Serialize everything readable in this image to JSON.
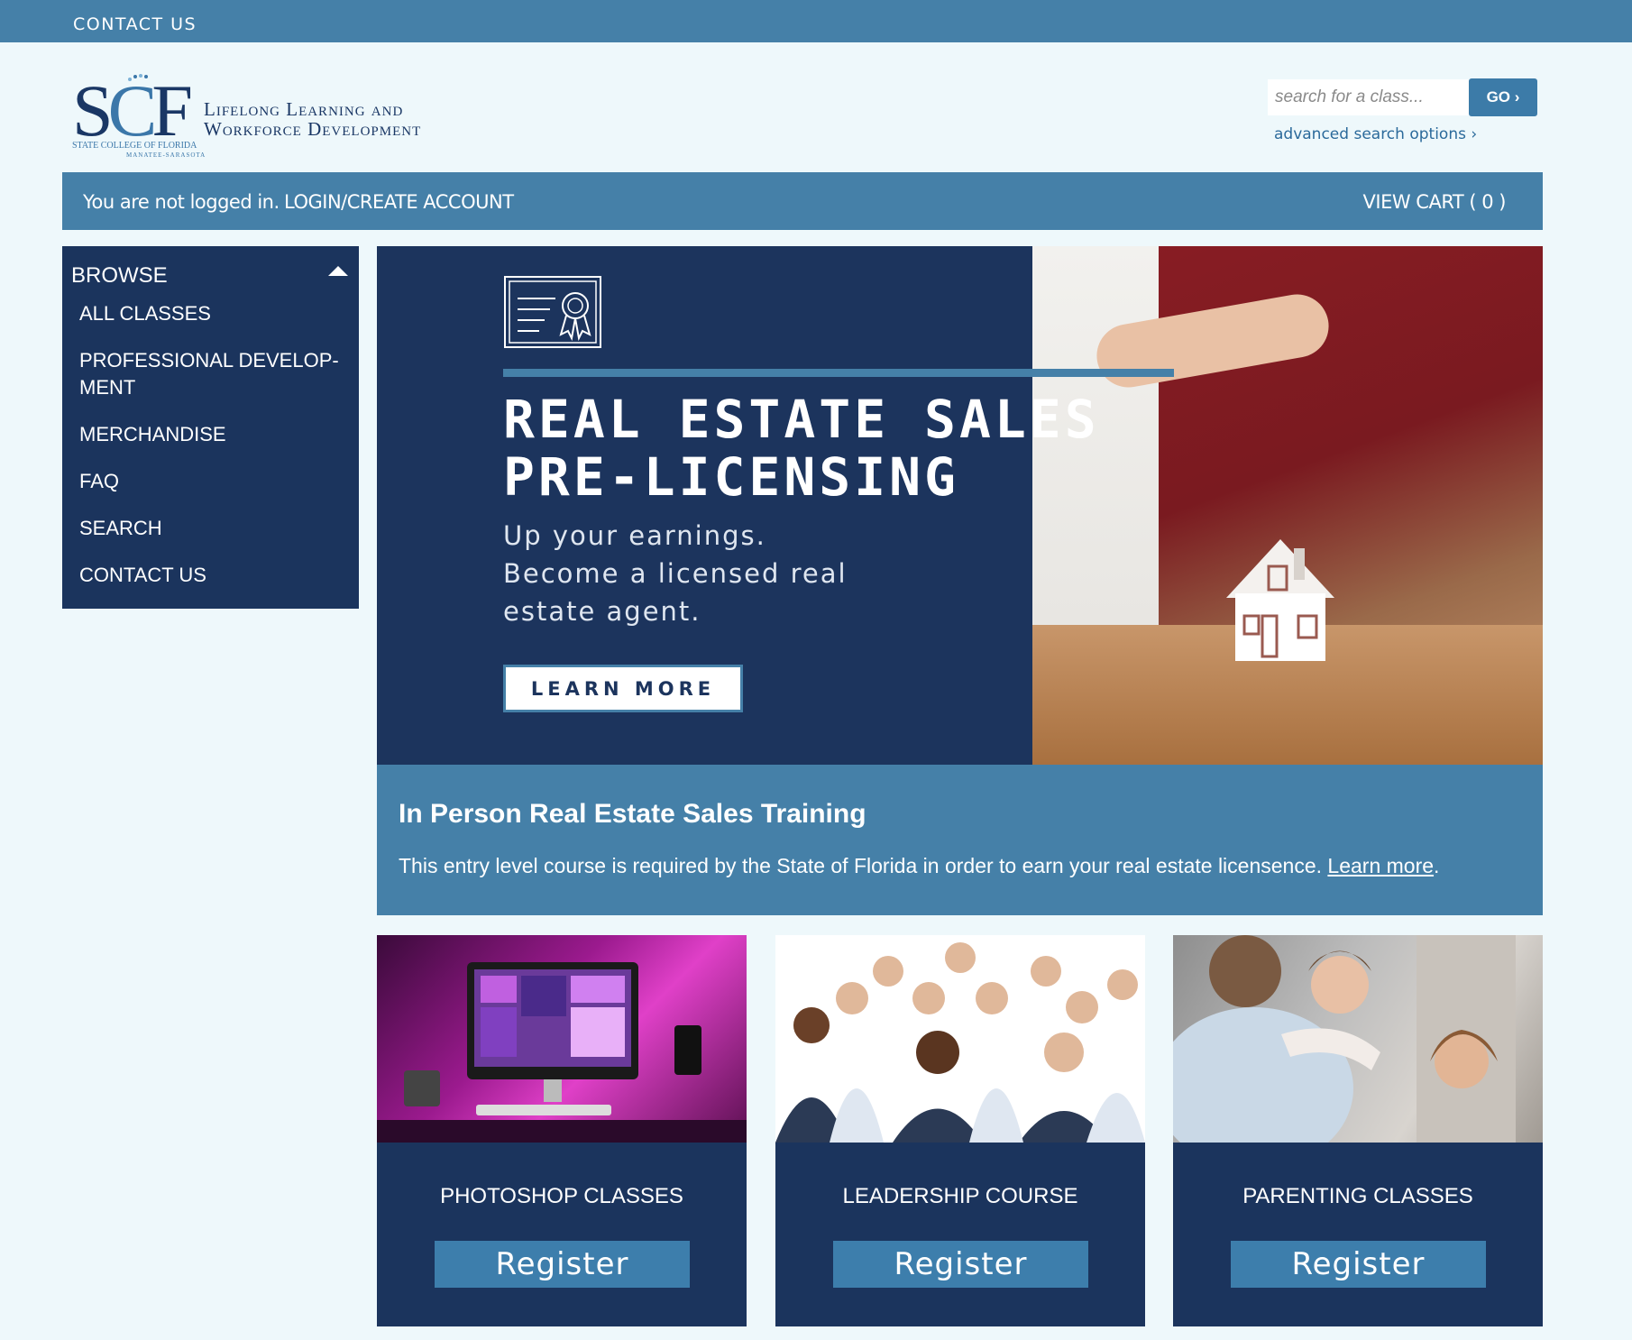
{
  "topbar": {
    "contact_label": "CONTACT US"
  },
  "logo": {
    "mark_s": "S",
    "mark_c": "C",
    "mark_f": "F",
    "line1": "Lifelong Learning and",
    "line2": "Workforce Development",
    "college": "STATE COLLEGE OF FLORIDA",
    "campus": "MANATEE-SARASOTA"
  },
  "search": {
    "placeholder": "search for a class...",
    "go_label": "GO ›",
    "advanced_label": "advanced search options ›"
  },
  "userbar": {
    "status": "You are not logged in.",
    "login_label": "LOGIN/CREATE ACCOUNT",
    "cart_label": "VIEW CART ( 0 )"
  },
  "sidebar": {
    "heading": "BROWSE",
    "items": [
      {
        "label": "ALL CLASSES"
      },
      {
        "label": "PROFESSIONAL DEVELOP-MENT"
      },
      {
        "label": "MERCHANDISE"
      },
      {
        "label": "FAQ"
      },
      {
        "label": "SEARCH"
      },
      {
        "label": "CONTACT US"
      }
    ]
  },
  "hero": {
    "title": "REAL ESTATE SALES\nPRE-LICENSING",
    "tagline": "Up your earnings. Become a licensed real estate agent.",
    "button_label": "LEARN MORE"
  },
  "promo": {
    "heading": "In Person Real Estate Sales Training",
    "text": "This entry level course is required by the State of Florida in order to earn your real estate licensence. ",
    "link_label": "Learn more",
    "suffix": "."
  },
  "cards": [
    {
      "label": "PHOTOSHOP CLASSES",
      "button_label": "Register"
    },
    {
      "label": "LEADERSHIP COURSE",
      "button_label": "Register"
    },
    {
      "label": "PARENTING CLASSES",
      "button_label": "Register"
    }
  ],
  "colors": {
    "page_bg": "#eef8fb",
    "accent_blue": "#4580a8",
    "navy": "#1b345d",
    "button_blue": "#3d7eac"
  }
}
